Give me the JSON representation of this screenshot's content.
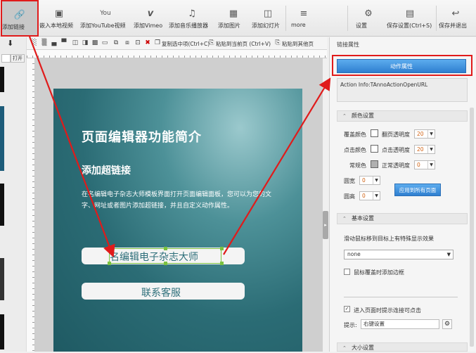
{
  "toolbar": {
    "items": [
      {
        "label": "添加链接",
        "icon": "link-icon"
      },
      {
        "label": "嵌入本地视频",
        "icon": "video-icon"
      },
      {
        "label": "添加YouTube视频",
        "icon": "youtube-icon"
      },
      {
        "label": "添加Vimeo",
        "icon": "vimeo-icon"
      },
      {
        "label": "添加音乐播放器",
        "icon": "music-icon"
      },
      {
        "label": "添加图片",
        "icon": "image-icon"
      },
      {
        "label": "添加幻灯片",
        "icon": "slideshow-icon"
      },
      {
        "label": "more",
        "icon": "more-icon"
      },
      {
        "label": "设置",
        "icon": "gear-icon"
      },
      {
        "label": "保存设置(Ctrl+S)",
        "icon": "save-icon"
      },
      {
        "label": "保存并退出",
        "icon": "exit-icon"
      }
    ]
  },
  "subbar": {
    "copy_label": "复制选中项(Ctrl+C)",
    "paste_current": "粘贴到当前页 (Ctrl+V)",
    "paste_other": "粘贴到其他页"
  },
  "left": {
    "open_label": "打开"
  },
  "page": {
    "title": "页面编辑器功能简介",
    "subtitle": "添加超链接",
    "paragraph": "在名编辑电子杂志大师模板界面打开页面编辑面板，您可以为您的文字、网址或者图片添加超链接，并且自定义动作属性。",
    "button1": "名编辑电子杂志大师",
    "button2": "联系客服"
  },
  "right": {
    "panel_title": "链接属性",
    "action_button": "动作属性",
    "action_info": "Action Info:TAnnoActionOpenURL",
    "color_section": "颜色设置",
    "cover_color": "覆盖颜色",
    "flip_opacity": "翻页透明度",
    "flip_opacity_value": "20",
    "click_color": "点击颜色",
    "click_opacity": "点击透明度",
    "click_opacity_value": "20",
    "normal_color": "常规色",
    "normal_opacity": "正常透明度",
    "normal_opacity_value": "0",
    "corner_w": "圆宽",
    "corner_w_value": "0",
    "corner_h": "圆高",
    "corner_h_value": "0",
    "apply_all": "应用到所有页面",
    "basic_section": "基本设置",
    "hover_effect": "滑动鼠标移到目标上有特殊显示效果",
    "hover_value": "none",
    "border_on_hover": "鼠标覆盖时添加边框",
    "hint_on_enter": "进入页面时提示连接可点击",
    "hint_label": "提示:",
    "hint_value": "右键设置",
    "size_section": "大小设置"
  },
  "colors": {
    "accent_red": "#e01b1b",
    "accent_blue": "#2f7fd0",
    "selection_green": "#7bc240"
  }
}
